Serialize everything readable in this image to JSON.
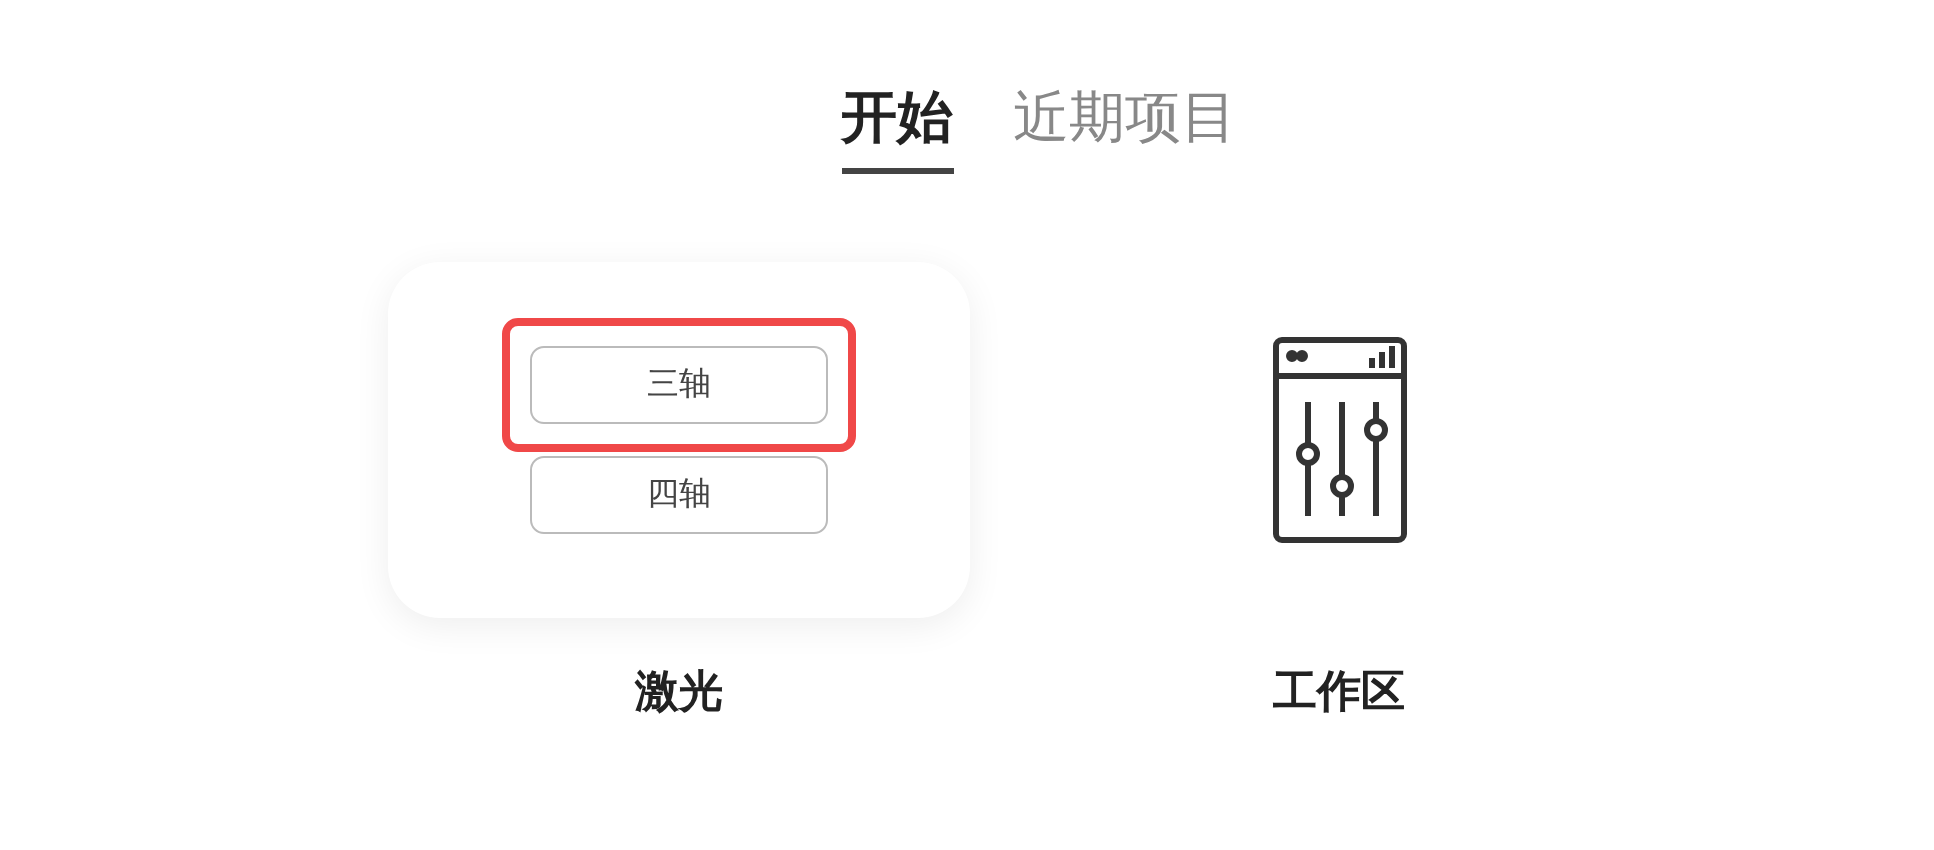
{
  "tabs": [
    {
      "label": "开始",
      "selected": true
    },
    {
      "label": "近期项目",
      "selected": false
    }
  ],
  "tiles": [
    {
      "kind": "options",
      "label": "激光",
      "options": [
        {
          "label": "三轴",
          "highlighted": true
        },
        {
          "label": "四轴",
          "highlighted": false
        }
      ]
    },
    {
      "kind": "icon",
      "label": "工作区"
    }
  ]
}
